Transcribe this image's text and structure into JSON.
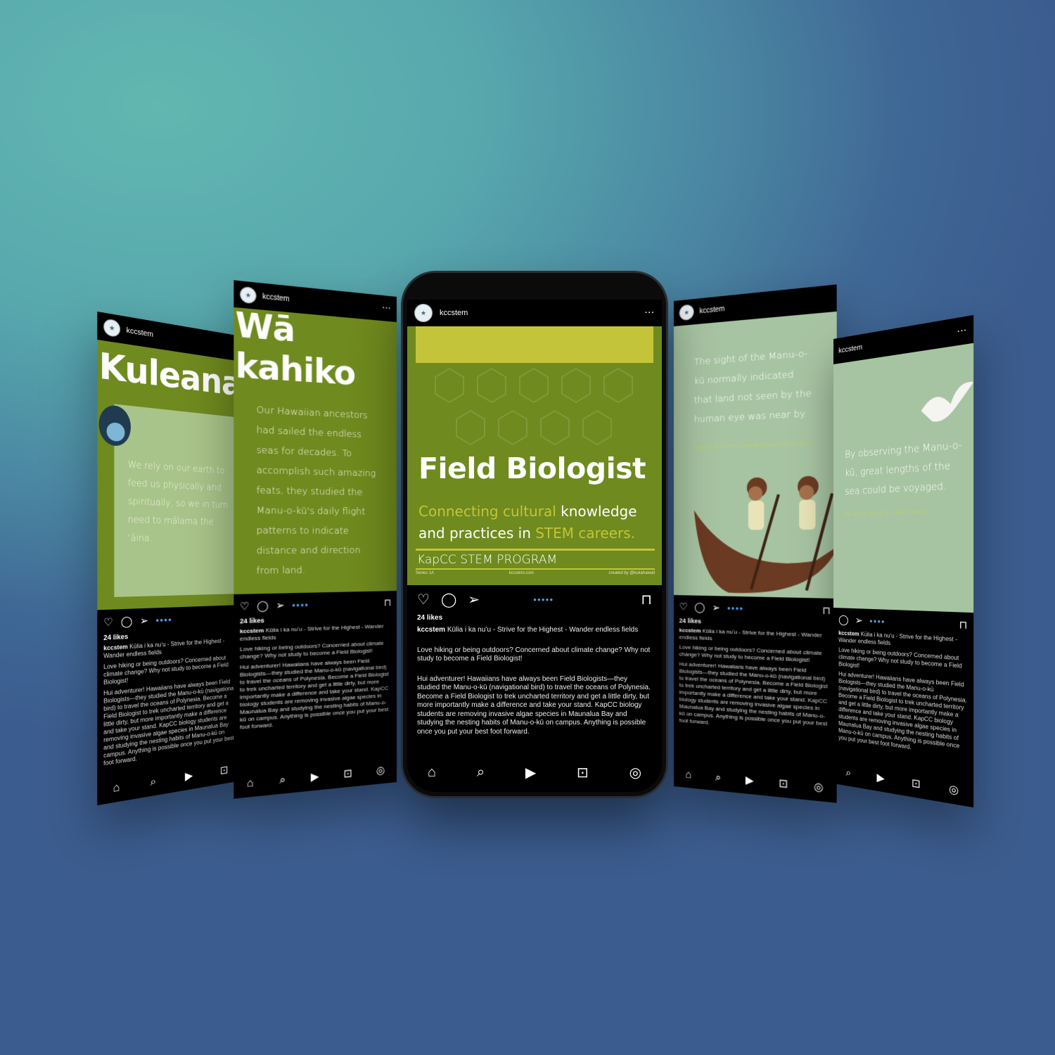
{
  "account": "kccstem",
  "likes": "24 likes",
  "caption": {
    "headline": "Kūlia i ka nuʻu - Strive for the Highest - Wander endless fields",
    "p1": "Love hiking or being outdoors? Concerned about climate change? Why not study to become a Field Biologist!",
    "p2": "Hui adventurer! Hawaiians have always been Field Biologists—they studied the Manu-o-kū (navigational bird) to travel the oceans of Polynesia. Become a Field Biologist to trek uncharted territory and get a little dirty, but more importantly make a difference and take your stand. KapCC biology students are removing invasive algae species in Maunalua Bay and studying the nesting habits of Manu-o-kū on campus. Anything is possible once you put your best foot forward."
  },
  "main_post": {
    "title": "Field Biologist",
    "sub_a": "Connecting cultural",
    "sub_b": " knowledge and practices in ",
    "sub_c": "STEM careers.",
    "program": "KapCC STEM PROGRAM",
    "footer_left": "Series 1A",
    "footer_mid": "kccstem.com",
    "footer_right": "created by @kukahawaii"
  },
  "post_kuleana": {
    "title": "Kuleana",
    "text": "We rely on our earth to feed us physically and spiritually, so we in turn need to mālama the ʻāina."
  },
  "post_wakahiko": {
    "title": "Wā kahiko",
    "text": "Our Hawaiian ancestors had sailed the endless seas for decades. To accomplish such amazing feats, they studied the Manu-o-kū's daily flight patterns to indicate distance and direction from land."
  },
  "post_sight": {
    "text": "The sight of the Manu-o-kū normally indicated that land not seen by the human eye was near by.",
    "note": "Manu-o-kū derives from the phrase \"land of Kū\""
  },
  "post_observing": {
    "text": "By observing the Manu-o-kū, great lengths of the sea could be voyaged.",
    "note": "Kū ʻalapa ʻau kaʻi ka ʻāina mamao"
  },
  "icons": {
    "heart": "♡",
    "comment": "◯",
    "share": "➢",
    "bookmark": "⊓",
    "home": "⌂",
    "search": "⌕",
    "reels": "▶",
    "shop": "⊡",
    "profile": "◎"
  },
  "colors": {
    "olive": "#6f8a1e",
    "lime": "#c4c43a",
    "sage": "#a7c4a2"
  }
}
